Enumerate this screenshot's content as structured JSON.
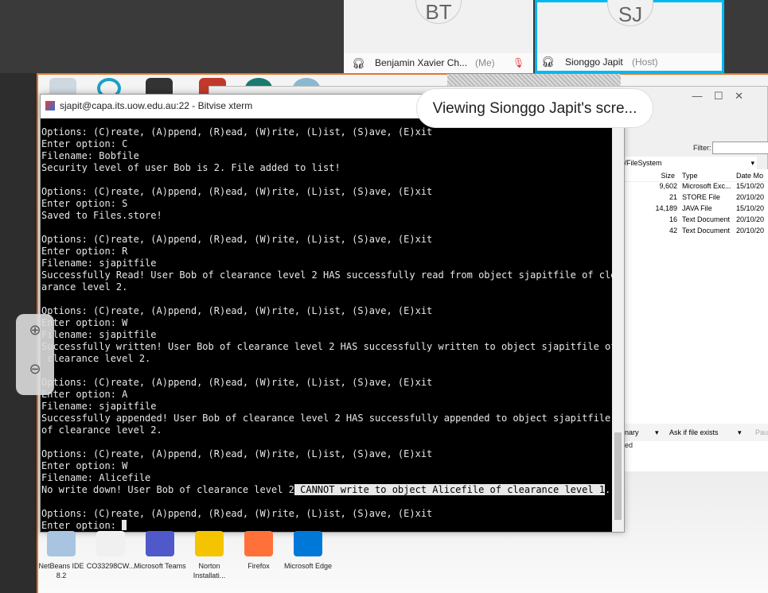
{
  "meeting": {
    "participants": [
      {
        "initials": "BT",
        "name": "Benjamin Xavier Ch...",
        "tag": "(Me)",
        "muted": true
      },
      {
        "initials": "SJ",
        "name": "Sionggo Japit",
        "tag": "(Host)",
        "active": true
      }
    ],
    "toast": "Viewing Sionggo Japit's scre...",
    "accent": "#00b8f0"
  },
  "sftp": {
    "filter_label": "Filter:",
    "path": "pit/FileSystem",
    "columns": [
      "Size",
      "Type",
      "Date Mo"
    ],
    "rows": [
      {
        "size": "9,602",
        "type": "Microsoft Exc...",
        "date": "15/10/20"
      },
      {
        "size": "21",
        "type": "STORE File",
        "date": "20/10/20"
      },
      {
        "size": "14,189",
        "type": "JAVA File",
        "date": "15/10/20"
      },
      {
        "size": "16",
        "type": "Text Document",
        "date": "20/10/20"
      },
      {
        "size": "42",
        "type": "Text Document",
        "date": "20/10/20"
      }
    ],
    "transfer_mode": "inary",
    "overwrite": "Ask if file exists",
    "pause": "Paus",
    "status": "ed"
  },
  "terminal": {
    "title": "sjapit@capa.its.uow.edu.au:22 - Bitvise xterm",
    "lines": [
      "Options: (C)reate, (A)ppend, (R)ead, (W)rite, (L)ist, (S)ave, (E)xit",
      "Enter option: C",
      "Filename: Bobfile",
      "Security level of user Bob is 2. File added to list!",
      "",
      "Options: (C)reate, (A)ppend, (R)ead, (W)rite, (L)ist, (S)ave, (E)xit",
      "Enter option: S",
      "Saved to Files.store!",
      "",
      "Options: (C)reate, (A)ppend, (R)ead, (W)rite, (L)ist, (S)ave, (E)xit",
      "Enter option: R",
      "Filename: sjapitfile",
      "Successfully Read! User Bob of clearance level 2 HAS successfully read from object sjapitfile of cle",
      "arance level 2.",
      "",
      "Options: (C)reate, (A)ppend, (R)ead, (W)rite, (L)ist, (S)ave, (E)xit",
      "Enter option: W",
      "Filename: sjapitfile",
      "Successfully written! User Bob of clearance level 2 HAS successfully written to object sjapitfile of",
      " clearance level 2.",
      "",
      "Options: (C)reate, (A)ppend, (R)ead, (W)rite, (L)ist, (S)ave, (E)xit",
      "Enter option: A",
      "Filename: sjapitfile",
      "Successfully appended! User Bob of clearance level 2 HAS successfully appended to object sjapitfile",
      "of clearance level 2.",
      "",
      "Options: (C)reate, (A)ppend, (R)ead, (W)rite, (L)ist, (S)ave, (E)xit",
      "Enter option: W",
      "Filename: Alicefile"
    ],
    "denied_prefix": "No write down! User Bob of clearance level 2",
    "denied_selected": " CANNOT write to object Alicefile of clearance level 1",
    "denied_suffix": ".",
    "final_lines": [
      "",
      "Options: (C)reate, (A)ppend, (R)ead, (W)rite, (L)ist, (S)ave, (E)xit"
    ],
    "prompt": "Enter option: "
  },
  "zoom": {
    "in": "⊕",
    "out": "⊖"
  },
  "desktop_icons": [
    {
      "label": "NetBeans IDE 8.2",
      "color": "#a8c4e0"
    },
    {
      "label": "CO33298CW...",
      "color": "#f0f0f0"
    },
    {
      "label": "Microsoft Teams",
      "color": "#5059c9"
    },
    {
      "label": "Norton Installati...",
      "color": "#f5c400"
    },
    {
      "label": "Firefox",
      "color": "#ff7139"
    },
    {
      "label": "Microsoft Edge",
      "color": "#0078d7"
    }
  ]
}
